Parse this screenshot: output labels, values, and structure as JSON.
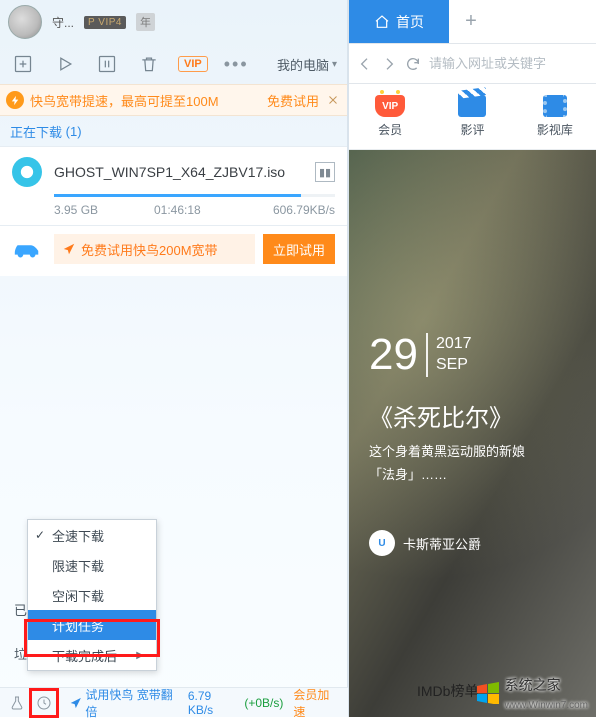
{
  "user": {
    "name": "守...",
    "vip_badge": "P VIP4",
    "year_badge": "年"
  },
  "toolbar": {
    "vip_label": "VIP",
    "mypc": "我的电脑"
  },
  "promo": {
    "text": "快鸟宽带提速，最高可提至100M",
    "try": "免费试用"
  },
  "tabs": {
    "downloading": "正在下载",
    "count": "(1)"
  },
  "task": {
    "title": "GHOST_WIN7SP1_X64_ZJBV17.iso",
    "size": "3.95 GB",
    "eta": "01:46:18",
    "speed": "606.79KB/s"
  },
  "trybar": {
    "text": "免费试用快鸟200M宽带",
    "btn": "立即试用"
  },
  "left_labels": {
    "done_prefix": "已",
    "trash_prefix": "垃"
  },
  "ctx": {
    "full": "全速下载",
    "limit": "限速下载",
    "idle": "空闲下载",
    "plan": "计划任务",
    "after": "下载完成后"
  },
  "status": {
    "provider": "试用快鸟 宽带翻倍",
    "speed_cut": "6.79 KB/s",
    "plus": "(+0B/s)",
    "accel": "会员加速"
  },
  "right": {
    "home": "首页",
    "search_placeholder": "请输入网址或关键字",
    "nav": {
      "member": "会员",
      "review": "影评",
      "library": "影视库",
      "vip_text": "VIP"
    },
    "hero": {
      "day": "29",
      "year": "2017",
      "month": "SEP",
      "title": "《杀死比尔》",
      "desc1": "这个身着黄黑运动服的新娘",
      "desc2": "「法身」……",
      "author": "卡斯蒂亚公爵",
      "imdb": "IMDb榜单"
    }
  },
  "watermark": {
    "brand": "系统之家",
    "url": "www.Winwin7.com"
  }
}
